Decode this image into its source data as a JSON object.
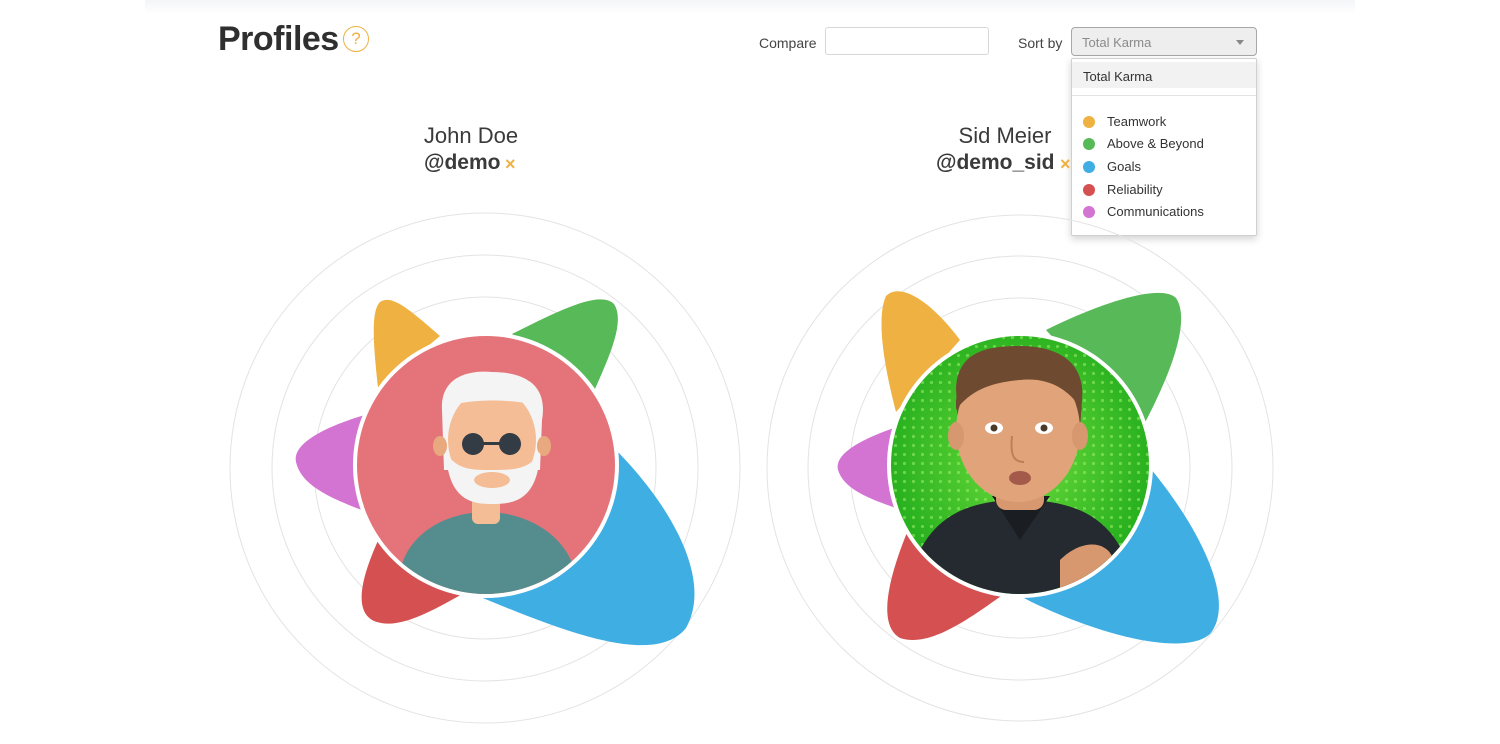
{
  "page": {
    "title": "Profiles",
    "help_icon_glyph": "?"
  },
  "compare": {
    "label": "Compare",
    "value": ""
  },
  "sort": {
    "label": "Sort by",
    "selected": "Total Karma"
  },
  "dropdown": {
    "top_option": "Total Karma",
    "items": [
      {
        "label": "Teamwork",
        "color": "#efb141"
      },
      {
        "label": "Above & Beyond",
        "color": "#57b957"
      },
      {
        "label": "Goals",
        "color": "#3faee3"
      },
      {
        "label": "Reliability",
        "color": "#d55050"
      },
      {
        "label": "Communications",
        "color": "#d374d3"
      }
    ]
  },
  "profiles": [
    {
      "name": "John Doe",
      "handle": "@demo",
      "remove_glyph": "×",
      "avatar": "illustrated-old-man-avatar"
    },
    {
      "name": "Sid Meier",
      "handle": "@demo_sid",
      "remove_glyph": "×",
      "avatar": "photo-portrait"
    }
  ],
  "colors": {
    "teamwork": "#efb141",
    "above_beyond": "#57b957",
    "goals": "#3faee3",
    "reliability": "#d55050",
    "communications": "#d374d3",
    "accent": "#efb141"
  }
}
